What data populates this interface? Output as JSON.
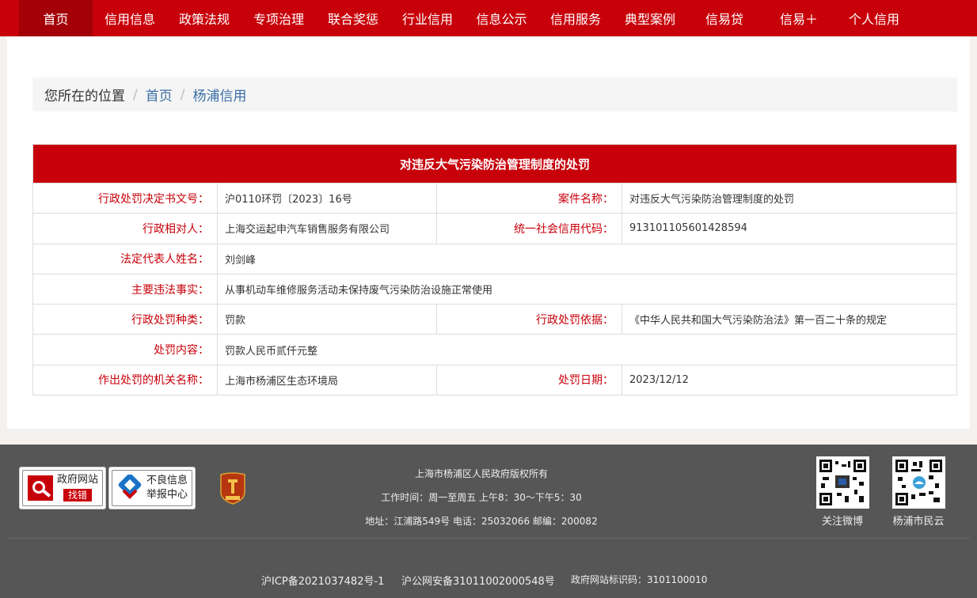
{
  "nav": {
    "items": [
      {
        "label": "首页",
        "active": true
      },
      {
        "label": "信用信息"
      },
      {
        "label": "政策法规"
      },
      {
        "label": "专项治理"
      },
      {
        "label": "联合奖惩"
      },
      {
        "label": "行业信用"
      },
      {
        "label": "信息公示"
      },
      {
        "label": "信用服务"
      },
      {
        "label": "典型案例"
      },
      {
        "label": "信易贷"
      },
      {
        "label": "信易＋"
      },
      {
        "label": "个人信用"
      }
    ]
  },
  "breadcrumb": {
    "label": "您所在的位置",
    "separator": "/",
    "links": [
      "首页",
      "杨浦信用"
    ]
  },
  "detail": {
    "title": "对违反大气污染防治管理制度的处罚",
    "rows": [
      {
        "l1": "行政处罚决定书文号：",
        "v1": "沪0110环罚〔2023〕16号",
        "l2": "案件名称：",
        "v2": "对违反大气污染防治管理制度的处罚"
      },
      {
        "l1": "行政相对人：",
        "v1": "上海交运起申汽车销售服务有限公司",
        "l2": "统一社会信用代码：",
        "v2": "913101105601428594"
      },
      {
        "l1": "法定代表人姓名：",
        "v1": "刘剑峰"
      },
      {
        "l1": "主要违法事实：",
        "v1": "从事机动车维修服务活动未保持废气污染防治设施正常使用"
      },
      {
        "l1": "行政处罚种类：",
        "v1": "罚款",
        "l2": "行政处罚依据：",
        "v2": "《中华人民共和国大气污染防治法》第一百二十条的规定"
      },
      {
        "l1": "处罚内容：",
        "v1": "罚款人民币贰仟元整"
      },
      {
        "l1": "作出处罚的机关名称：",
        "v1": "上海市杨浦区生态环境局",
        "l2": "处罚日期：",
        "v2": "2023/12/12"
      }
    ]
  },
  "footer": {
    "badge1": {
      "line1": "政府网站",
      "line2": "找错"
    },
    "badge2": {
      "line1": "不良信息",
      "line2": "举报中心"
    },
    "copyright": "上海市杨浦区人民政府版权所有",
    "hours": "工作时间：周一至周五  上午8：30～下午5：30",
    "address": "地址：江浦路549号 电话：25032066 邮编：200082",
    "qr1_label": "关注微博",
    "qr2_label": "杨浦市民云",
    "icp": "沪ICP备2021037482号-1",
    "police": "沪公网安备31011002000548号",
    "site_id": "政府网站标识码：3101100010"
  },
  "colors": {
    "brand_red": "#c8000a",
    "footer_bg": "#565656"
  }
}
